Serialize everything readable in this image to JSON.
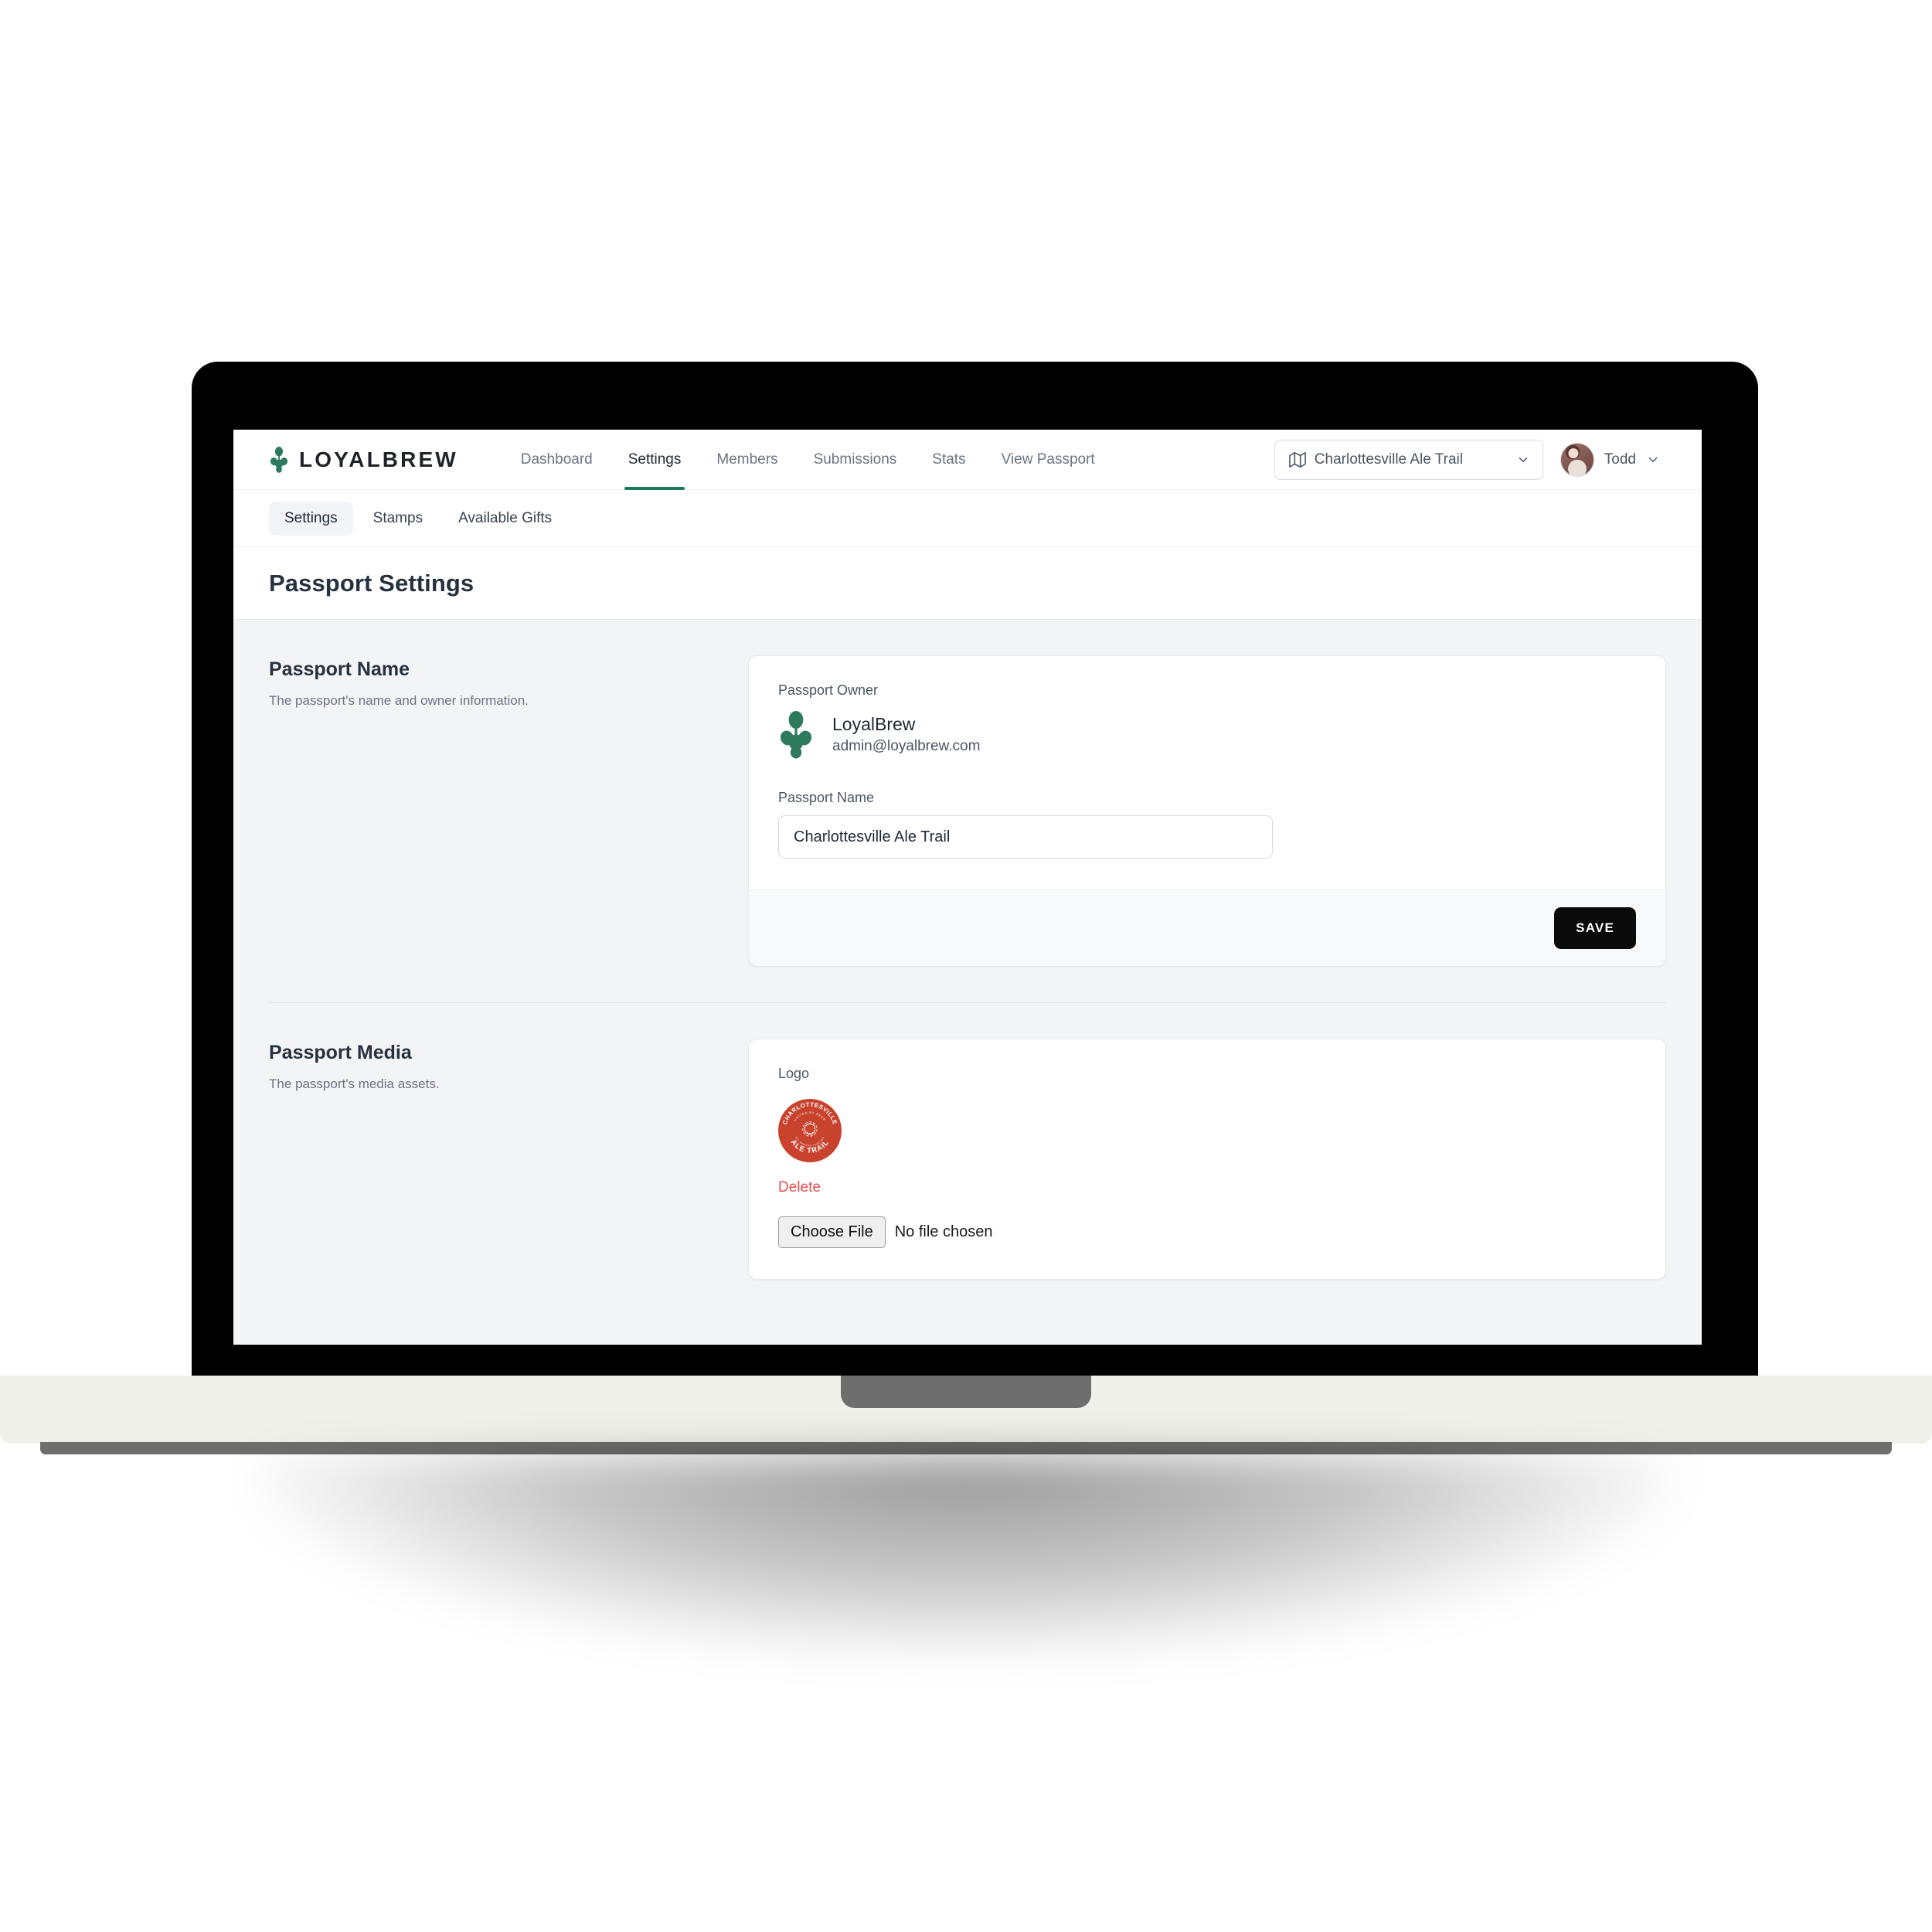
{
  "brand": {
    "word": "LOYALBREW",
    "mark_icon": "hop-cone-icon"
  },
  "topnav": {
    "items": [
      {
        "label": "Dashboard",
        "active": false
      },
      {
        "label": "Settings",
        "active": true
      },
      {
        "label": "Members",
        "active": false
      },
      {
        "label": "Submissions",
        "active": false
      },
      {
        "label": "Stats",
        "active": false
      },
      {
        "label": "View Passport",
        "active": false
      }
    ]
  },
  "passport_selector": {
    "icon": "map-icon",
    "selected": "Charlottesville Ale Trail",
    "chevron_icon": "chevron-down-icon"
  },
  "user_menu": {
    "name": "Todd",
    "avatar_icon": "user-avatar",
    "chevron_icon": "chevron-down-icon"
  },
  "subnav": {
    "tabs": [
      {
        "label": "Settings",
        "active": true
      },
      {
        "label": "Stamps",
        "active": false
      },
      {
        "label": "Available Gifts",
        "active": false
      }
    ]
  },
  "page": {
    "title": "Passport Settings"
  },
  "sections": {
    "passport_name": {
      "heading": "Passport Name",
      "description": "The passport's name and owner information.",
      "owner_label": "Passport Owner",
      "owner_icon": "hop-cone-icon",
      "owner_name": "LoyalBrew",
      "owner_email": "admin@loyalbrew.com",
      "input_label": "Passport Name",
      "input_value": "Charlottesville Ale Trail",
      "input_placeholder": "Passport Name",
      "save_label": "SAVE"
    },
    "passport_media": {
      "heading": "Passport Media",
      "description": "The passport's media assets.",
      "logo_label": "Logo",
      "logo_icon": "ale-trail-badge",
      "logo_top_text": "CHARLOTTESVILLE",
      "logo_bottom_text": "ALE TRAIL",
      "logo_center_text": "UNITED BY BEER",
      "delete_label": "Delete",
      "file_button_label": "Choose File",
      "file_status": "No file chosen"
    }
  },
  "colors": {
    "brand_green": "#2d7a5f",
    "accent_green": "#1b7a5a",
    "danger_red": "#ea4e4e",
    "logo_red": "#c9422e",
    "save_black": "#0a0a0a",
    "page_bg": "#f3f4f6"
  }
}
